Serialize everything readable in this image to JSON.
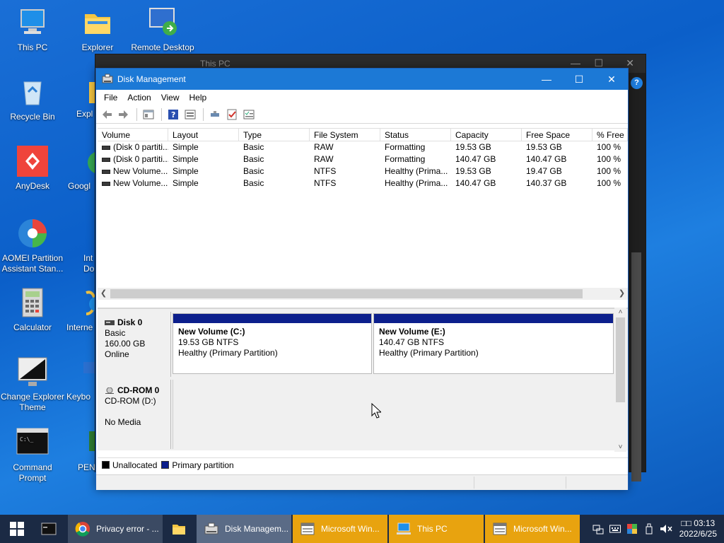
{
  "desktop": {
    "icons": [
      {
        "label": "This PC"
      },
      {
        "label": "Explorer"
      },
      {
        "label": "Remote Desktop"
      },
      {
        "label": "Recycle Bin"
      },
      {
        "label": "Expl"
      },
      {
        "label": "AnyDesk"
      },
      {
        "label": "Googl"
      },
      {
        "label": "AOMEI Partition Assistant Stan..."
      },
      {
        "label": "Int Do"
      },
      {
        "label": "Calculator"
      },
      {
        "label": "Interne"
      },
      {
        "label": "Change Explorer Theme"
      },
      {
        "label": "Keybo"
      },
      {
        "label": "Command Prompt"
      },
      {
        "label": "PEN"
      }
    ]
  },
  "background_window": {
    "title": "This PC",
    "help": "?"
  },
  "window": {
    "title": "Disk Management",
    "controls": {
      "minimize": "—",
      "maximize": "☐",
      "close": "✕"
    },
    "menu": [
      "File",
      "Action",
      "View",
      "Help"
    ]
  },
  "volume_list": {
    "columns": [
      "Volume",
      "Layout",
      "Type",
      "File System",
      "Status",
      "Capacity",
      "Free Space",
      "% Free"
    ],
    "rows": [
      [
        "(Disk 0 partiti...",
        "Simple",
        "Basic",
        "RAW",
        "Formatting",
        "19.53 GB",
        "19.53 GB",
        "100 %"
      ],
      [
        "(Disk 0 partiti...",
        "Simple",
        "Basic",
        "RAW",
        "Formatting",
        "140.47 GB",
        "140.47 GB",
        "100 %"
      ],
      [
        "New Volume...",
        "Simple",
        "Basic",
        "NTFS",
        "Healthy (Prima...",
        "19.53 GB",
        "19.47 GB",
        "100 %"
      ],
      [
        "New Volume...",
        "Simple",
        "Basic",
        "NTFS",
        "Healthy (Prima...",
        "140.47 GB",
        "140.37 GB",
        "100 %"
      ]
    ]
  },
  "disks": {
    "disk0": {
      "name": "Disk 0",
      "type": "Basic",
      "size": "160.00 GB",
      "state": "Online",
      "partitions": [
        {
          "name": "New Volume  (C:)",
          "size": "19.53 GB NTFS",
          "status": "Healthy (Primary Partition)"
        },
        {
          "name": "New Volume  (E:)",
          "size": "140.47 GB NTFS",
          "status": "Healthy (Primary Partition)"
        }
      ]
    },
    "cdrom0": {
      "name": "CD-ROM 0",
      "drive": "CD-ROM (D:)",
      "media": "No Media"
    }
  },
  "legend": {
    "unallocated": "Unallocated",
    "unallocated_color": "#000000",
    "primary": "Primary partition",
    "primary_color": "#0c1f8c"
  },
  "taskbar": {
    "buttons": [
      {
        "label": "Privacy error - ...",
        "icon": "chrome-icon"
      },
      {
        "label": "",
        "icon": "folder-icon"
      },
      {
        "label": "Disk Managem...",
        "icon": "disk-management-icon"
      },
      {
        "label": "Microsoft Win...",
        "icon": "window-icon"
      },
      {
        "label": "This PC",
        "icon": "computer-icon"
      },
      {
        "label": "Microsoft Win...",
        "icon": "window-icon"
      }
    ],
    "clock": {
      "time": "□□ 03:13",
      "date": "2022/6/25"
    }
  }
}
